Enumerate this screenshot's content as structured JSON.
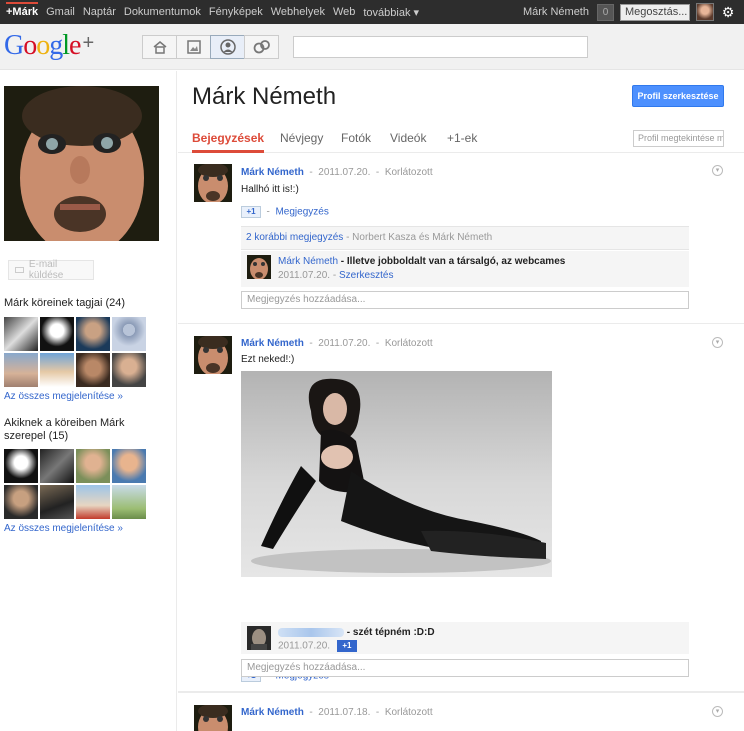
{
  "topbar": {
    "nav": [
      "+Márk",
      "Gmail",
      "Naptár",
      "Dokumentumok",
      "Fényképek",
      "Webhelyek",
      "Web",
      "továbbiak ▾"
    ],
    "user_name": "Márk Németh",
    "notification_count": "0",
    "share_label": "Megosztás..."
  },
  "logo": {
    "text": "Google",
    "plus": "+"
  },
  "left": {
    "email_label": "E-mail küldése",
    "circles_title": "Márk köreinek tagjai (24)",
    "show_all_1": "Az összes megjelenítése »",
    "in_circles_title": "Akiknek a köreiben Márk szerepel (15)",
    "show_all_2": "Az összes megjelenítése »"
  },
  "profile": {
    "name": "Márk Németh",
    "edit_label": "Profil szerkesztése",
    "view_placeholder": "Profil megtekintése m",
    "tabs": [
      "Bejegyzések",
      "Névjegy",
      "Fotók",
      "Videók",
      "+1-ek"
    ]
  },
  "posts": [
    {
      "author": "Márk Németh",
      "date": "2011.07.20.",
      "visibility": "Korlátozott",
      "text": "Hallhó itt is!:)",
      "plusone": "+1",
      "comment_link": "Megjegyzés",
      "previous_comments": "2 korábbi megjegyzés",
      "previous_by": "Norbert Kasza és Márk Németh",
      "comment": {
        "author": "Márk Németh",
        "text": "Illetve jobboldalt van a társalgó, az webcames",
        "date": "2011.07.20.",
        "edit": "Szerkesztés"
      },
      "add_comment": "Megjegyzés hozzáadása..."
    },
    {
      "author": "Márk Németh",
      "date": "2011.07.20.",
      "visibility": "Korlátozott",
      "text": "Ezt neked!:)",
      "plusone": "+1",
      "comment_link": "Megjegyzés",
      "comment": {
        "text": "szét tépném :D:D",
        "date": "2011.07.20.",
        "plusone": "+1"
      },
      "add_comment": "Megjegyzés hozzáadása..."
    },
    {
      "author": "Márk Németh",
      "date": "2011.07.18.",
      "visibility": "Korlátozott"
    }
  ],
  "colors": {
    "accent_red": "#dd4b39",
    "link_blue": "#3366cc",
    "button_blue": "#4d90fe"
  }
}
